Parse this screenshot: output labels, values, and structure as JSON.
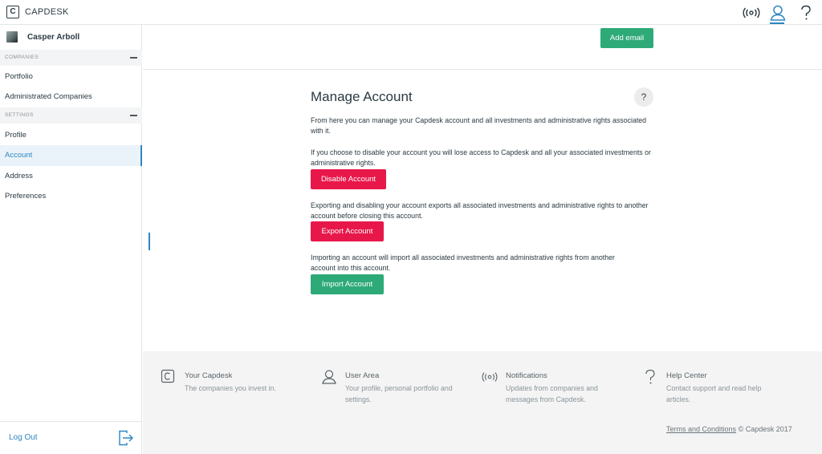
{
  "app": {
    "logo_letter": "C",
    "brand": "CAPDESK"
  },
  "header": {
    "icons": [
      "broadcast-icon",
      "user-icon",
      "help-icon"
    ]
  },
  "sidebar": {
    "user_name": "Casper Arboll",
    "sections": [
      {
        "label": "COMPANIES",
        "items": [
          {
            "label": "Portfolio"
          },
          {
            "label": "Administrated Companies"
          }
        ]
      },
      {
        "label": "SETTINGS",
        "items": [
          {
            "label": "Profile"
          },
          {
            "label": "Account",
            "active": true
          },
          {
            "label": "Address"
          },
          {
            "label": "Preferences"
          }
        ]
      }
    ],
    "logout_label": "Log Out"
  },
  "email": {
    "add_email_label": "Add email"
  },
  "manage": {
    "title": "Manage Account",
    "help_symbol": "?",
    "intro": "From here you can manage your Capdesk account and all investments and administrative rights associated with it.",
    "disable_text": "If you choose to disable your account you will lose access to Capdesk and all your associated investments or administrative rights.",
    "disable_label": "Disable Account",
    "export_text": "Exporting and disabling your account exports all associated investments and administrative rights to another account before closing this account.",
    "export_label": "Export Account",
    "import_text": "Importing an account will import all associated investments and administrative rights from another account into this account.",
    "import_label": "Import Account"
  },
  "footer": {
    "columns": [
      {
        "icon": "capdesk-logo-icon",
        "title": "Your Capdesk",
        "desc": "The companies you invest in."
      },
      {
        "icon": "user-icon",
        "title": "User Area",
        "desc": "Your profile, personal portfolio and settings."
      },
      {
        "icon": "broadcast-icon",
        "title": "Notifications",
        "desc": "Updates from companies and messages from Capdesk."
      },
      {
        "icon": "help-icon",
        "title": "Help Center",
        "desc": "Contact support and read help articles."
      }
    ],
    "terms_label": "Terms and Conditions",
    "copyright": "© Capdesk 2017"
  },
  "colors": {
    "accent": "#2e86c1",
    "green": "#2eaa78",
    "red": "#e8174a"
  }
}
